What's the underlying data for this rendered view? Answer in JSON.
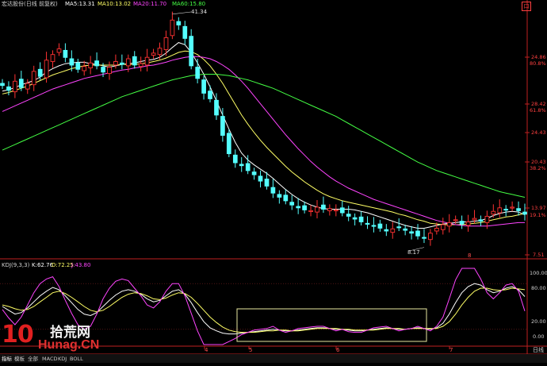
{
  "header": {
    "title": "宏达股份(日线 前复权)",
    "ma": [
      {
        "label": "MA5:13.31",
        "color": "#ffffff"
      },
      {
        "label": "MA10:13.02",
        "color": "#ffff66"
      },
      {
        "label": "MA20:11.70",
        "color": "#ff44ff"
      },
      {
        "label": "MA60:15.80",
        "color": "#44ff44"
      }
    ]
  },
  "kdj_header": {
    "title": "KDJ(9,3,3)",
    "k": "K:62.76",
    "d": "D:72.25",
    "j": "J:43.80",
    "k_color": "#ffffff",
    "d_color": "#ffff66",
    "j_color": "#ff44ff"
  },
  "price_axis": {
    "ticks": [
      "24.86",
      "28.42",
      "24.43",
      "20.43",
      "13.97",
      "7.51"
    ],
    "pcts": [
      "80.8%",
      "61.8%",
      "38.2%",
      "19.1%"
    ]
  },
  "kdj_axis": {
    "ticks": [
      "100.00",
      "80.00",
      "20.00",
      "0.00"
    ]
  },
  "annotations": {
    "high": "41.34",
    "low": "8.17"
  },
  "months": [
    "4",
    "5",
    "6",
    "7",
    "8"
  ],
  "corner_label": "日线",
  "top_right_mark": "口",
  "bottom_tabs": [
    "指标",
    "模板",
    "全部",
    "MACD",
    "KDJ",
    "BOLL"
  ],
  "watermark": {
    "big": "10",
    "cn": "拾荒网",
    "en": "Hunag.CN"
  },
  "chart_data": {
    "type": "candlestick",
    "title": "宏达股份(日线 前复权)",
    "price_range": [
      7.51,
      41.34
    ],
    "series": [
      {
        "name": "MA5",
        "color": "#ffffff",
        "values": [
          30.4,
          30.6,
          30.9,
          31.3,
          31.6,
          31.9,
          32.4,
          33.1,
          33.6,
          34.0,
          34.3,
          34.4,
          34.5,
          34.5,
          34.3,
          34.2,
          34.0,
          33.8,
          34.0,
          34.2,
          34.3,
          34.4,
          34.6,
          34.8,
          34.9,
          35.2,
          35.8,
          36.6,
          37.3,
          37.0,
          35.9,
          34.4,
          32.8,
          31.0,
          29.0,
          27.0,
          25.0,
          23.1,
          21.6,
          20.6,
          19.9,
          19.3,
          18.7,
          18.0,
          17.2,
          16.4,
          15.7,
          15.1,
          14.6,
          14.2,
          13.9,
          13.7,
          13.6,
          13.6,
          13.6,
          13.6,
          13.5,
          13.3,
          13.1,
          12.8,
          12.5,
          12.2,
          11.9,
          11.6,
          11.3,
          11.1,
          10.9,
          10.9,
          11.1,
          11.3,
          11.5,
          11.6,
          11.7,
          11.8,
          11.8,
          11.9,
          12.0,
          12.3,
          12.7,
          13.0,
          13.2,
          13.3,
          13.2,
          12.8
        ]
      },
      {
        "name": "MA10",
        "color": "#ffff66",
        "values": [
          30.0,
          30.2,
          30.5,
          30.8,
          31.1,
          31.5,
          31.9,
          32.3,
          32.7,
          33.0,
          33.3,
          33.6,
          33.8,
          34.0,
          34.1,
          34.1,
          34.1,
          34.1,
          34.1,
          34.2,
          34.2,
          34.2,
          34.3,
          34.4,
          34.6,
          34.8,
          35.1,
          35.5,
          35.9,
          36.1,
          36.0,
          35.6,
          34.9,
          34.0,
          32.8,
          31.5,
          30.0,
          28.5,
          27.0,
          25.7,
          24.5,
          23.4,
          22.4,
          21.5,
          20.6,
          19.7,
          18.9,
          18.2,
          17.5,
          16.9,
          16.3,
          15.8,
          15.4,
          15.1,
          14.8,
          14.6,
          14.4,
          14.2,
          14.0,
          13.8,
          13.6,
          13.4,
          13.2,
          12.9,
          12.7,
          12.4,
          12.1,
          11.9,
          11.6,
          11.5,
          11.4,
          11.4,
          11.4,
          11.4,
          11.5,
          11.6,
          11.7,
          11.9,
          12.1,
          12.3,
          12.5,
          12.6,
          12.8,
          13.0
        ]
      },
      {
        "name": "MA20",
        "color": "#ff44ff",
        "values": [
          27.5,
          27.9,
          28.3,
          28.7,
          29.1,
          29.5,
          29.9,
          30.3,
          30.7,
          31.0,
          31.3,
          31.6,
          31.9,
          32.2,
          32.4,
          32.6,
          32.8,
          33.0,
          33.2,
          33.4,
          33.5,
          33.7,
          33.8,
          34.0,
          34.1,
          34.3,
          34.5,
          34.8,
          35.0,
          35.2,
          35.3,
          35.3,
          35.2,
          35.0,
          34.6,
          34.1,
          33.5,
          32.7,
          31.8,
          30.8,
          29.7,
          28.6,
          27.5,
          26.4,
          25.3,
          24.2,
          23.2,
          22.2,
          21.3,
          20.4,
          19.6,
          18.9,
          18.2,
          17.6,
          17.1,
          16.6,
          16.2,
          15.8,
          15.4,
          15.0,
          14.7,
          14.4,
          14.1,
          13.8,
          13.5,
          13.2,
          12.9,
          12.6,
          12.3,
          12.0,
          11.8,
          11.6,
          11.4,
          11.3,
          11.2,
          11.2,
          11.2,
          11.2,
          11.3,
          11.4,
          11.5,
          11.6,
          11.7,
          11.7
        ]
      },
      {
        "name": "MA60",
        "color": "#44ff44",
        "values": [
          22.0,
          22.4,
          22.8,
          23.2,
          23.6,
          24.0,
          24.4,
          24.8,
          25.2,
          25.6,
          26.0,
          26.4,
          26.8,
          27.2,
          27.6,
          28.0,
          28.4,
          28.8,
          29.2,
          29.6,
          29.9,
          30.2,
          30.5,
          30.8,
          31.1,
          31.4,
          31.7,
          32.0,
          32.2,
          32.4,
          32.6,
          32.7,
          32.8,
          32.8,
          32.8,
          32.7,
          32.6,
          32.4,
          32.2,
          32.0,
          31.7,
          31.4,
          31.1,
          30.8,
          30.4,
          30.0,
          29.6,
          29.2,
          28.8,
          28.4,
          28.0,
          27.6,
          27.2,
          26.8,
          26.3,
          25.8,
          25.3,
          24.8,
          24.3,
          23.8,
          23.3,
          22.8,
          22.3,
          21.8,
          21.3,
          20.8,
          20.3,
          19.9,
          19.5,
          19.1,
          18.8,
          18.5,
          18.2,
          17.9,
          17.6,
          17.3,
          17.0,
          16.7,
          16.4,
          16.1,
          15.9,
          15.7,
          15.5,
          15.3
        ]
      }
    ],
    "candles_close": [
      31.2,
      30.5,
      31.8,
      30.9,
      31.5,
      33.2,
      32.5,
      34.8,
      35.6,
      36.4,
      35.2,
      34.1,
      33.5,
      33.9,
      34.4,
      34.0,
      33.1,
      33.8,
      34.6,
      34.2,
      35.0,
      34.1,
      34.3,
      35.2,
      35.8,
      36.5,
      38.0,
      40.5,
      39.8,
      37.9,
      34.0,
      32.2,
      30.1,
      29.3,
      27.0,
      24.1,
      21.5,
      20.2,
      19.8,
      19.1,
      18.5,
      17.6,
      16.9,
      15.9,
      15.3,
      14.8,
      14.2,
      13.8,
      13.5,
      13.4,
      13.9,
      13.6,
      13.7,
      13.5,
      13.1,
      12.6,
      12.2,
      11.8,
      11.5,
      11.2,
      10.9,
      10.5,
      10.8,
      11.0,
      10.6,
      10.2,
      9.8,
      9.5,
      10.2,
      10.9,
      11.4,
      11.7,
      12.1,
      11.5,
      11.8,
      12.3,
      11.9,
      12.6,
      13.3,
      13.8,
      13.5,
      13.9,
      13.4,
      12.9
    ],
    "kdj": {
      "title": "KDJ(9,3,3)",
      "ylim": [
        0,
        100
      ],
      "series": [
        {
          "name": "K",
          "color": "#ffffff",
          "values": [
            50,
            45,
            40,
            42,
            48,
            56,
            64,
            70,
            75,
            72,
            64,
            55,
            46,
            40,
            38,
            42,
            50,
            58,
            65,
            70,
            72,
            70,
            66,
            60,
            56,
            58,
            64,
            70,
            72,
            66,
            55,
            42,
            30,
            22,
            18,
            15,
            14,
            14,
            15,
            16,
            17,
            18,
            19,
            20,
            19,
            18,
            18,
            19,
            20,
            21,
            22,
            22,
            21,
            20,
            20,
            19,
            18,
            18,
            19,
            20,
            21,
            22,
            21,
            20,
            20,
            21,
            22,
            21,
            20,
            22,
            28,
            40,
            55,
            68,
            76,
            80,
            78,
            72,
            68,
            70,
            74,
            76,
            72,
            63
          ]
        },
        {
          "name": "D",
          "color": "#ffff66",
          "values": [
            52,
            50,
            47,
            45,
            46,
            50,
            56,
            62,
            68,
            70,
            67,
            62,
            56,
            50,
            45,
            43,
            45,
            50,
            56,
            62,
            66,
            68,
            67,
            64,
            60,
            59,
            61,
            65,
            68,
            67,
            62,
            54,
            45,
            36,
            29,
            23,
            19,
            17,
            16,
            16,
            16,
            17,
            18,
            18,
            19,
            19,
            18,
            18,
            19,
            20,
            21,
            21,
            21,
            21,
            20,
            20,
            19,
            19,
            19,
            19,
            20,
            21,
            21,
            21,
            20,
            21,
            21,
            21,
            21,
            21,
            24,
            30,
            40,
            52,
            62,
            70,
            74,
            74,
            72,
            71,
            72,
            74,
            73,
            72
          ]
        },
        {
          "name": "J",
          "color": "#ff44ff",
          "values": [
            46,
            35,
            26,
            36,
            52,
            68,
            80,
            86,
            89,
            76,
            58,
            41,
            26,
            20,
            24,
            40,
            60,
            74,
            83,
            86,
            84,
            74,
            64,
            52,
            48,
            56,
            70,
            80,
            80,
            64,
            41,
            18,
            0,
            0,
            0,
            0,
            4,
            8,
            13,
            16,
            19,
            20,
            21,
            24,
            19,
            16,
            18,
            21,
            22,
            23,
            24,
            24,
            21,
            18,
            20,
            17,
            16,
            16,
            19,
            22,
            23,
            24,
            21,
            18,
            20,
            21,
            24,
            21,
            18,
            24,
            36,
            60,
            85,
            100,
            100,
            100,
            86,
            68,
            60,
            68,
            78,
            80,
            70,
            44
          ]
        }
      ]
    }
  }
}
